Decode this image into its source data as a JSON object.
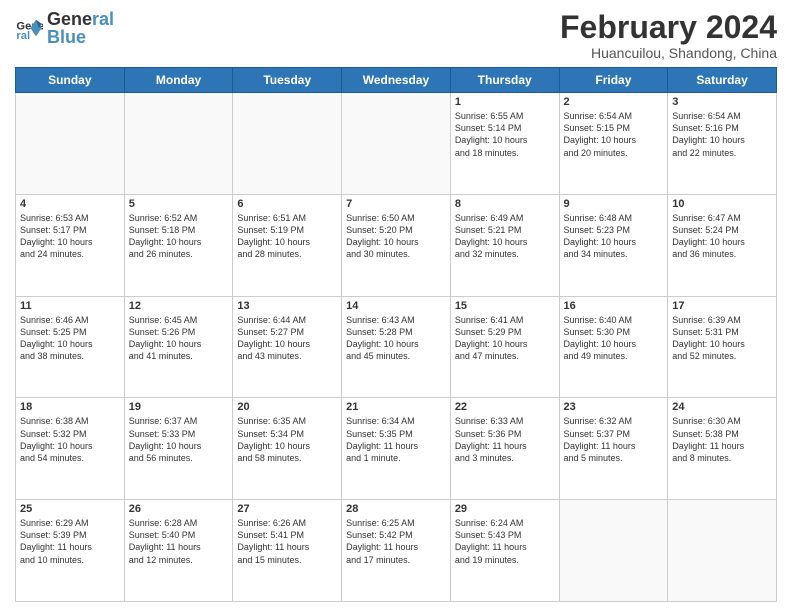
{
  "header": {
    "logo_general": "General",
    "logo_blue": "Blue",
    "month_title": "February 2024",
    "subtitle": "Huancuilou, Shandong, China"
  },
  "days": [
    "Sunday",
    "Monday",
    "Tuesday",
    "Wednesday",
    "Thursday",
    "Friday",
    "Saturday"
  ],
  "weeks": [
    [
      {
        "day": "",
        "info": ""
      },
      {
        "day": "",
        "info": ""
      },
      {
        "day": "",
        "info": ""
      },
      {
        "day": "",
        "info": ""
      },
      {
        "day": "1",
        "info": "Sunrise: 6:55 AM\nSunset: 5:14 PM\nDaylight: 10 hours\nand 18 minutes."
      },
      {
        "day": "2",
        "info": "Sunrise: 6:54 AM\nSunset: 5:15 PM\nDaylight: 10 hours\nand 20 minutes."
      },
      {
        "day": "3",
        "info": "Sunrise: 6:54 AM\nSunset: 5:16 PM\nDaylight: 10 hours\nand 22 minutes."
      }
    ],
    [
      {
        "day": "4",
        "info": "Sunrise: 6:53 AM\nSunset: 5:17 PM\nDaylight: 10 hours\nand 24 minutes."
      },
      {
        "day": "5",
        "info": "Sunrise: 6:52 AM\nSunset: 5:18 PM\nDaylight: 10 hours\nand 26 minutes."
      },
      {
        "day": "6",
        "info": "Sunrise: 6:51 AM\nSunset: 5:19 PM\nDaylight: 10 hours\nand 28 minutes."
      },
      {
        "day": "7",
        "info": "Sunrise: 6:50 AM\nSunset: 5:20 PM\nDaylight: 10 hours\nand 30 minutes."
      },
      {
        "day": "8",
        "info": "Sunrise: 6:49 AM\nSunset: 5:21 PM\nDaylight: 10 hours\nand 32 minutes."
      },
      {
        "day": "9",
        "info": "Sunrise: 6:48 AM\nSunset: 5:23 PM\nDaylight: 10 hours\nand 34 minutes."
      },
      {
        "day": "10",
        "info": "Sunrise: 6:47 AM\nSunset: 5:24 PM\nDaylight: 10 hours\nand 36 minutes."
      }
    ],
    [
      {
        "day": "11",
        "info": "Sunrise: 6:46 AM\nSunset: 5:25 PM\nDaylight: 10 hours\nand 38 minutes."
      },
      {
        "day": "12",
        "info": "Sunrise: 6:45 AM\nSunset: 5:26 PM\nDaylight: 10 hours\nand 41 minutes."
      },
      {
        "day": "13",
        "info": "Sunrise: 6:44 AM\nSunset: 5:27 PM\nDaylight: 10 hours\nand 43 minutes."
      },
      {
        "day": "14",
        "info": "Sunrise: 6:43 AM\nSunset: 5:28 PM\nDaylight: 10 hours\nand 45 minutes."
      },
      {
        "day": "15",
        "info": "Sunrise: 6:41 AM\nSunset: 5:29 PM\nDaylight: 10 hours\nand 47 minutes."
      },
      {
        "day": "16",
        "info": "Sunrise: 6:40 AM\nSunset: 5:30 PM\nDaylight: 10 hours\nand 49 minutes."
      },
      {
        "day": "17",
        "info": "Sunrise: 6:39 AM\nSunset: 5:31 PM\nDaylight: 10 hours\nand 52 minutes."
      }
    ],
    [
      {
        "day": "18",
        "info": "Sunrise: 6:38 AM\nSunset: 5:32 PM\nDaylight: 10 hours\nand 54 minutes."
      },
      {
        "day": "19",
        "info": "Sunrise: 6:37 AM\nSunset: 5:33 PM\nDaylight: 10 hours\nand 56 minutes."
      },
      {
        "day": "20",
        "info": "Sunrise: 6:35 AM\nSunset: 5:34 PM\nDaylight: 10 hours\nand 58 minutes."
      },
      {
        "day": "21",
        "info": "Sunrise: 6:34 AM\nSunset: 5:35 PM\nDaylight: 11 hours\nand 1 minute."
      },
      {
        "day": "22",
        "info": "Sunrise: 6:33 AM\nSunset: 5:36 PM\nDaylight: 11 hours\nand 3 minutes."
      },
      {
        "day": "23",
        "info": "Sunrise: 6:32 AM\nSunset: 5:37 PM\nDaylight: 11 hours\nand 5 minutes."
      },
      {
        "day": "24",
        "info": "Sunrise: 6:30 AM\nSunset: 5:38 PM\nDaylight: 11 hours\nand 8 minutes."
      }
    ],
    [
      {
        "day": "25",
        "info": "Sunrise: 6:29 AM\nSunset: 5:39 PM\nDaylight: 11 hours\nand 10 minutes."
      },
      {
        "day": "26",
        "info": "Sunrise: 6:28 AM\nSunset: 5:40 PM\nDaylight: 11 hours\nand 12 minutes."
      },
      {
        "day": "27",
        "info": "Sunrise: 6:26 AM\nSunset: 5:41 PM\nDaylight: 11 hours\nand 15 minutes."
      },
      {
        "day": "28",
        "info": "Sunrise: 6:25 AM\nSunset: 5:42 PM\nDaylight: 11 hours\nand 17 minutes."
      },
      {
        "day": "29",
        "info": "Sunrise: 6:24 AM\nSunset: 5:43 PM\nDaylight: 11 hours\nand 19 minutes."
      },
      {
        "day": "",
        "info": ""
      },
      {
        "day": "",
        "info": ""
      }
    ]
  ]
}
